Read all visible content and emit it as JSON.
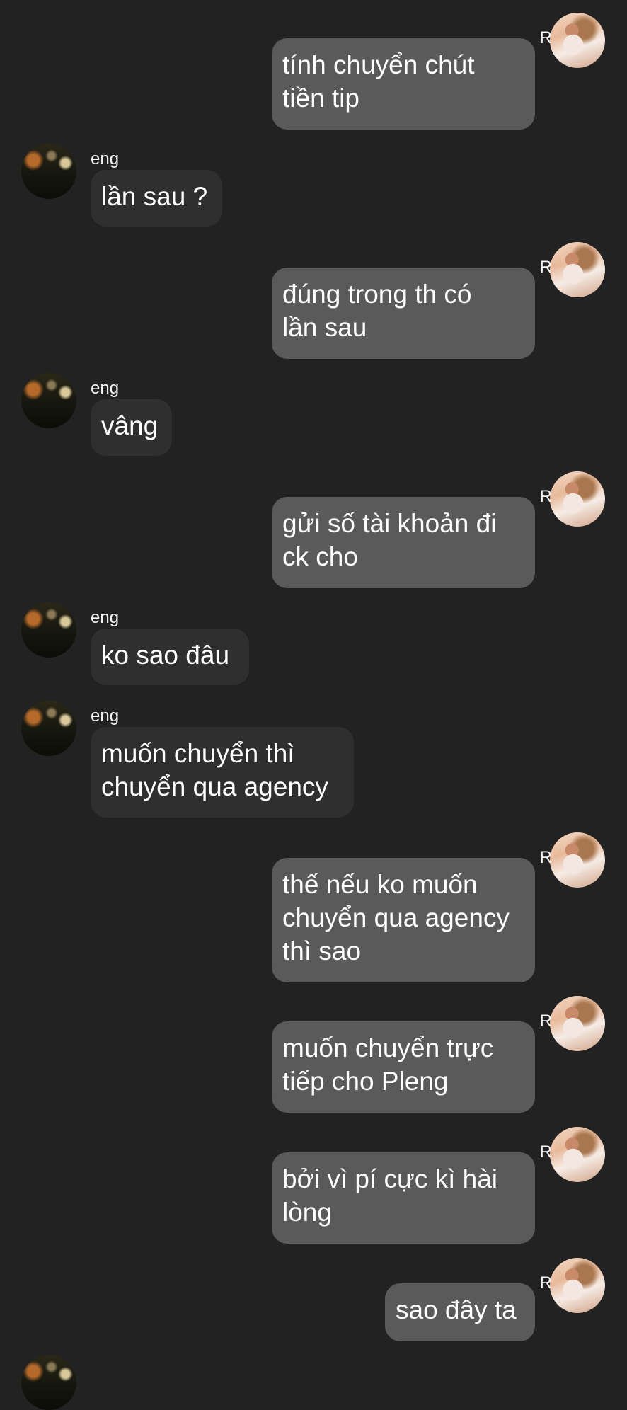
{
  "messages": [
    {
      "sender": "R",
      "side": "self",
      "text": "tính chuyển chút\ntiền tip"
    },
    {
      "sender": "eng",
      "side": "other",
      "text": "lần sau ?"
    },
    {
      "sender": "R",
      "side": "self",
      "text": "đúng trong th có\nlần sau"
    },
    {
      "sender": "eng",
      "side": "other",
      "text": "vâng"
    },
    {
      "sender": "R",
      "side": "self",
      "text": "gửi số tài khoản đi\nck cho"
    },
    {
      "sender": "eng",
      "side": "other",
      "text": "ko sao đâu"
    },
    {
      "sender": "eng",
      "side": "other",
      "text": "muốn chuyển thì\nchuyển qua agency"
    },
    {
      "sender": "R",
      "side": "self",
      "text": "thế nếu ko muốn\nchuyển qua agency\nthì sao"
    },
    {
      "sender": "R",
      "side": "self",
      "text": "muốn chuyển trực\ntiếp cho Pleng"
    },
    {
      "sender": "R",
      "side": "self",
      "text": "bởi vì pí cực kì hài\nlòng"
    },
    {
      "sender": "R",
      "side": "self",
      "text": "sao đây ta"
    }
  ],
  "colors": {
    "background": "#222222",
    "bubble_self": "#5a5a5a",
    "bubble_other": "#2f2f2f"
  }
}
